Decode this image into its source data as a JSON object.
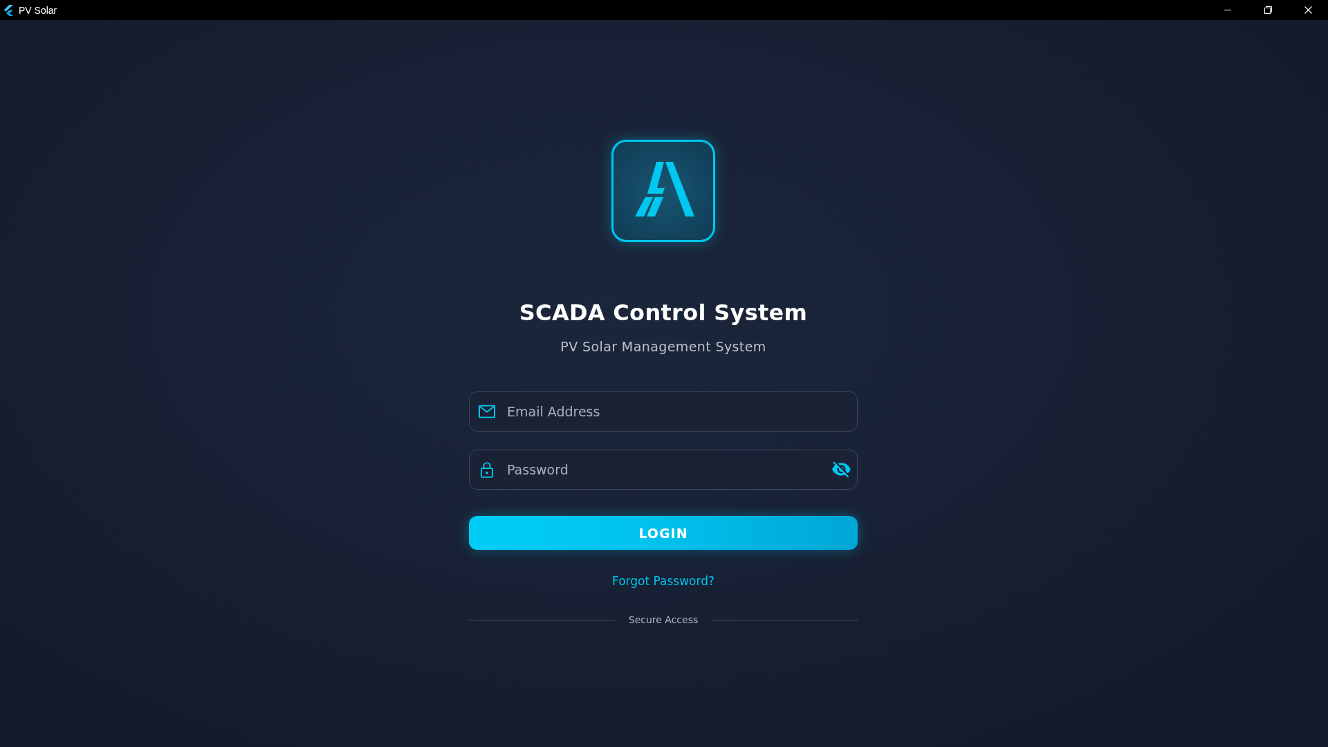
{
  "window": {
    "title": "PV Solar",
    "maximized": true
  },
  "header": {
    "title": "SCADA Control System",
    "subtitle": "PV Solar Management System"
  },
  "form": {
    "fields": [
      {
        "kind": "email",
        "placeholder": "Email Address"
      },
      {
        "kind": "password",
        "placeholder": "Password",
        "revealed": false
      }
    ],
    "login_button": "LOGIN",
    "forgot_link": "Forgot Password?",
    "divider_label": "Secure Access"
  }
}
